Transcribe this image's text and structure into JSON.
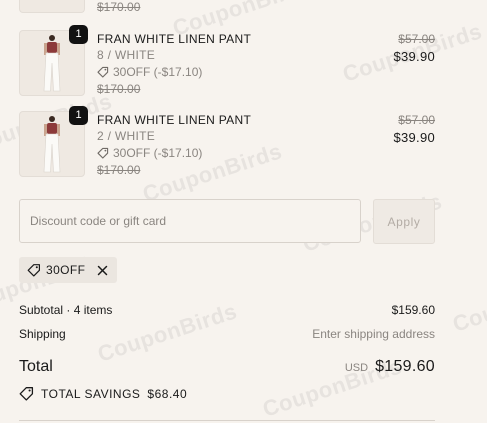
{
  "items_partial": {
    "old_price": "$170.00"
  },
  "items": [
    {
      "quantity": "1",
      "name": "FRAN WHITE LINEN PANT",
      "variant": "8 / WHITE",
      "discount": "30OFF (-$17.10)",
      "old_price": "$170.00",
      "compare_price": "$57.00",
      "price": "$39.90"
    },
    {
      "quantity": "1",
      "name": "FRAN WHITE LINEN PANT",
      "variant": "2 / WHITE",
      "discount": "30OFF (-$17.10)",
      "old_price": "$170.00",
      "compare_price": "$57.00",
      "price": "$39.90"
    }
  ],
  "discount_field": {
    "placeholder": "Discount code or gift card",
    "value": "",
    "apply_label": "Apply"
  },
  "applied_code": {
    "label": "30OFF"
  },
  "summary": {
    "subtotal_label": "Subtotal · 4 items",
    "subtotal_value": "$159.60",
    "shipping_label": "Shipping",
    "shipping_value": "Enter shipping address",
    "total_label": "Total",
    "currency": "USD",
    "total_value": "$159.60",
    "savings_label": "TOTAL SAVINGS",
    "savings_value": "$68.40"
  },
  "watermark": "CouponBirds",
  "colors": {
    "background": "#f7f3ee",
    "text": "#1a1a1a",
    "muted": "#8a8580",
    "badge": "#111111"
  }
}
